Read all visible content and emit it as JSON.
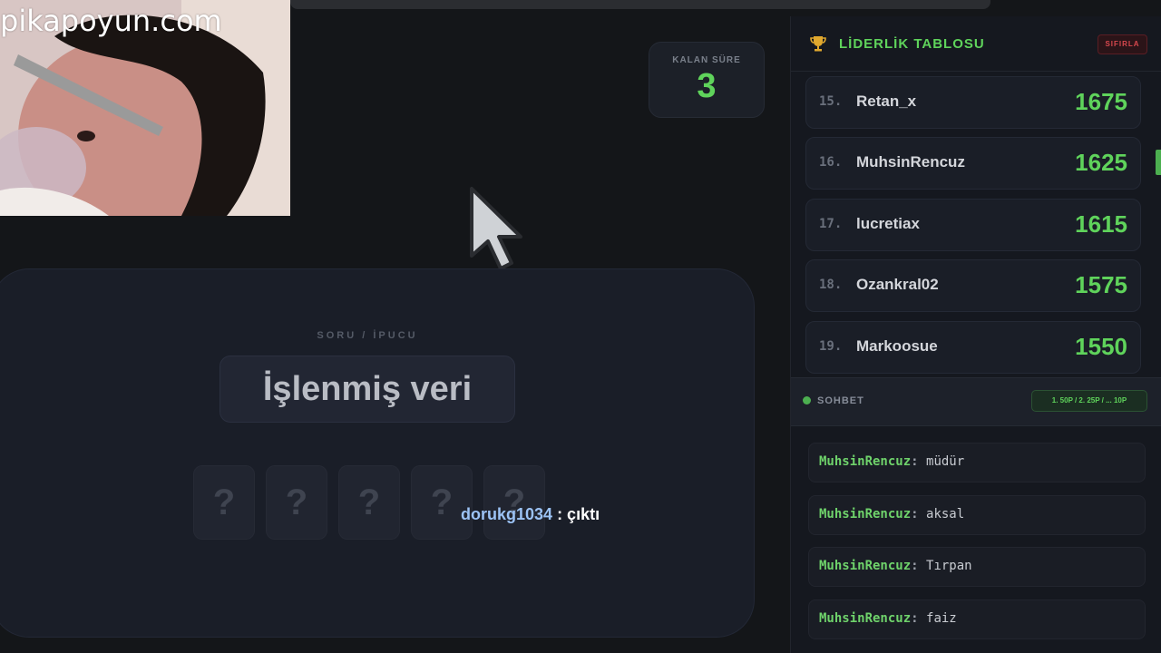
{
  "watermark": "pikapoyun.com",
  "timer": {
    "label": "KALAN SÜRE",
    "value": "3"
  },
  "question": {
    "label": "SORU / İPUCU",
    "clue": "İşlenmiş veri",
    "tiles": [
      "?",
      "?",
      "?",
      "?",
      "?"
    ]
  },
  "notification": {
    "user": "dorukg1034",
    "message": ": çıktı"
  },
  "leaderboard": {
    "title": "LİDERLİK TABLOSU",
    "reset_label": "SIFIRLA",
    "rows": [
      {
        "rank": "15.",
        "name": "Retan_x",
        "score": "1675"
      },
      {
        "rank": "16.",
        "name": "MuhsinRencuz",
        "score": "1625"
      },
      {
        "rank": "17.",
        "name": "lucretiax",
        "score": "1615"
      },
      {
        "rank": "18.",
        "name": "Ozankral02",
        "score": "1575"
      },
      {
        "rank": "19.",
        "name": "Markoosue",
        "score": "1550"
      }
    ]
  },
  "chat": {
    "title": "SOHBET",
    "points_badge": "1. 50P / 2. 25P / ... 10P",
    "messages": [
      {
        "user": "MuhsinRencuz",
        "text": "müdür"
      },
      {
        "user": "MuhsinRencuz",
        "text": "aksal"
      },
      {
        "user": "MuhsinRencuz",
        "text": "Tırpan"
      },
      {
        "user": "MuhsinRencuz",
        "text": "faiz"
      }
    ]
  },
  "colors": {
    "accent": "#5fd35b",
    "danger": "#d9484e",
    "background": "#141619"
  },
  "icons": {
    "leaderboard": "trophy-icon",
    "cursor": "mouse-pointer-icon",
    "chat_status": "online-dot-icon"
  }
}
